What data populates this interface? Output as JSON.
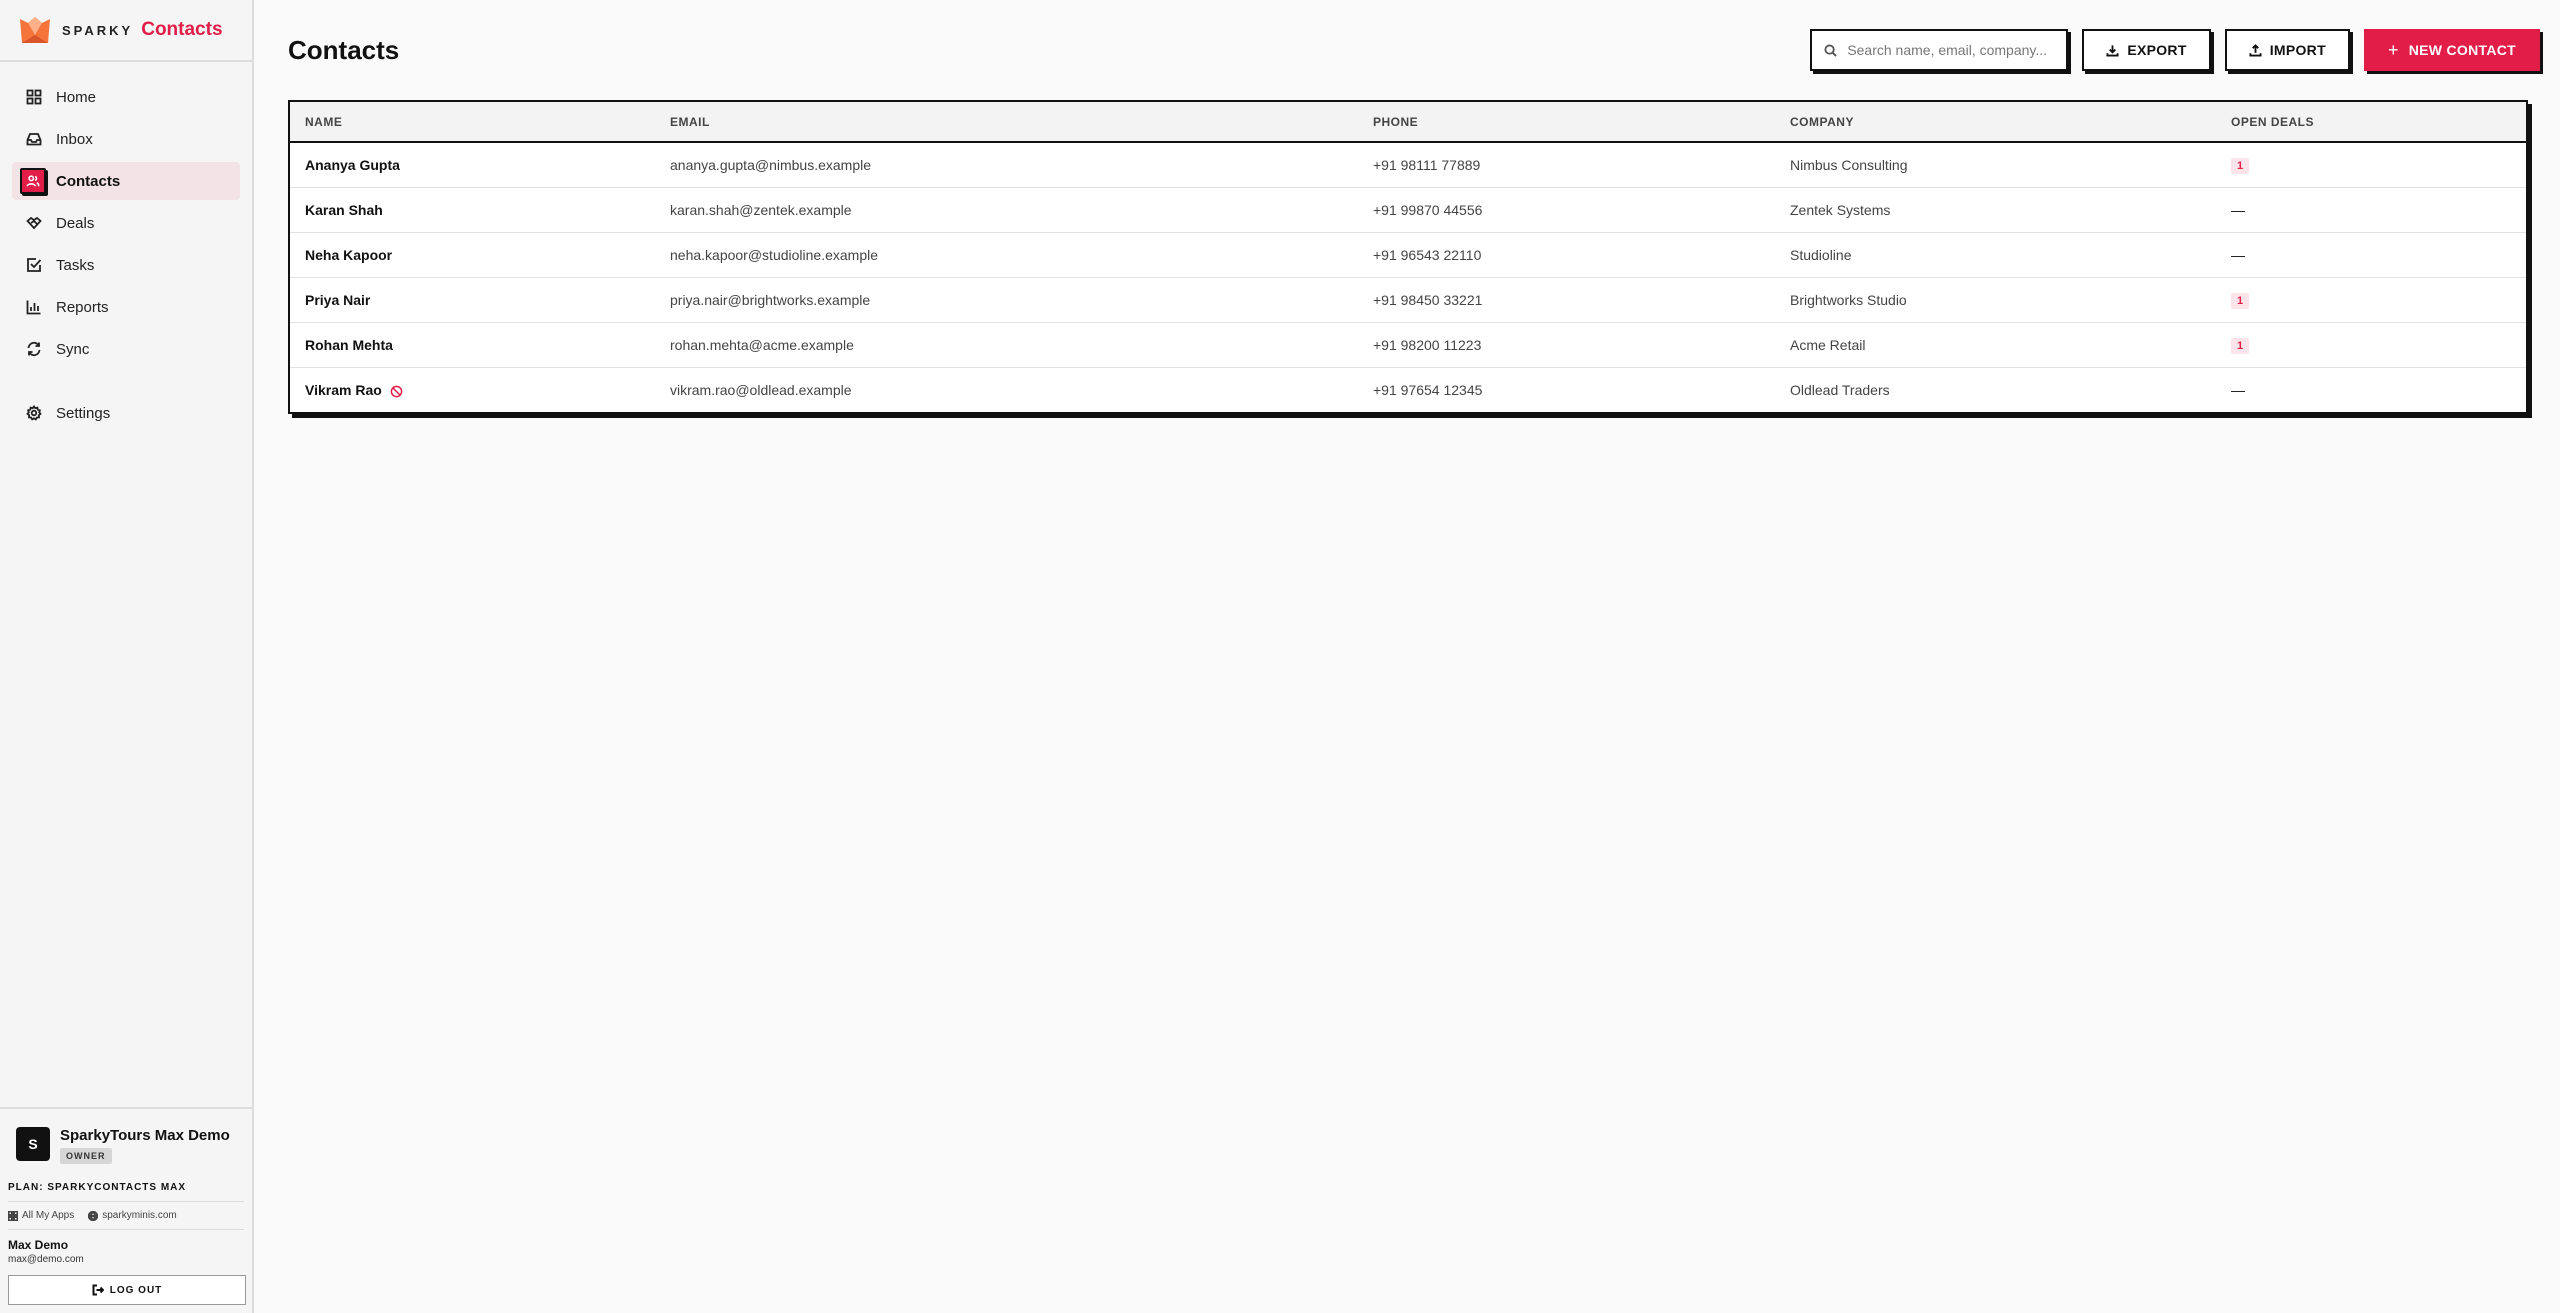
{
  "brand": {
    "prefix": "SPARKY",
    "app": "Contacts"
  },
  "nav": {
    "items": [
      {
        "label": "Home",
        "icon": "grid-icon"
      },
      {
        "label": "Inbox",
        "icon": "inbox-icon"
      },
      {
        "label": "Contacts",
        "icon": "users-icon",
        "active": true
      },
      {
        "label": "Deals",
        "icon": "handshake-icon"
      },
      {
        "label": "Tasks",
        "icon": "checkbox-icon"
      },
      {
        "label": "Reports",
        "icon": "bar-chart-icon"
      },
      {
        "label": "Sync",
        "icon": "refresh-icon"
      }
    ],
    "settings": {
      "label": "Settings",
      "icon": "gear-icon"
    }
  },
  "org": {
    "avatar": "S",
    "name": "SparkyTours Max Demo",
    "role": "OWNER"
  },
  "plan": "PLAN: SPARKYCONTACTS MAX",
  "links": {
    "apps": "All My Apps",
    "site": "sparkyminis.com"
  },
  "user": {
    "name": "Max Demo",
    "email": "max@demo.com",
    "logout": "LOG OUT"
  },
  "header": {
    "title": "Contacts",
    "search_placeholder": "Search name, email, company...",
    "export": "EXPORT",
    "import": "IMPORT",
    "new_contact": "NEW CONTACT"
  },
  "table": {
    "columns": [
      "NAME",
      "EMAIL",
      "PHONE",
      "COMPANY",
      "OPEN DEALS"
    ],
    "rows": [
      {
        "name": "Ananya Gupta",
        "email": "ananya.gupta@nimbus.example",
        "phone": "+91 98111 77889",
        "company": "Nimbus Consulting",
        "deals": "1",
        "dnc": false
      },
      {
        "name": "Karan Shah",
        "email": "karan.shah@zentek.example",
        "phone": "+91 99870 44556",
        "company": "Zentek Systems",
        "deals": "—",
        "dnc": false
      },
      {
        "name": "Neha Kapoor",
        "email": "neha.kapoor@studioline.example",
        "phone": "+91 96543 22110",
        "company": "Studioline",
        "deals": "—",
        "dnc": false
      },
      {
        "name": "Priya Nair",
        "email": "priya.nair@brightworks.example",
        "phone": "+91 98450 33221",
        "company": "Brightworks Studio",
        "deals": "1",
        "dnc": false
      },
      {
        "name": "Rohan Mehta",
        "email": "rohan.mehta@acme.example",
        "phone": "+91 98200 11223",
        "company": "Acme Retail",
        "deals": "1",
        "dnc": false
      },
      {
        "name": "Vikram Rao",
        "email": "vikram.rao@oldlead.example",
        "phone": "+91 97654 12345",
        "company": "Oldlead Traders",
        "deals": "—",
        "dnc": true
      }
    ]
  },
  "colors": {
    "accent": "#e11d48",
    "border": "#111111"
  }
}
